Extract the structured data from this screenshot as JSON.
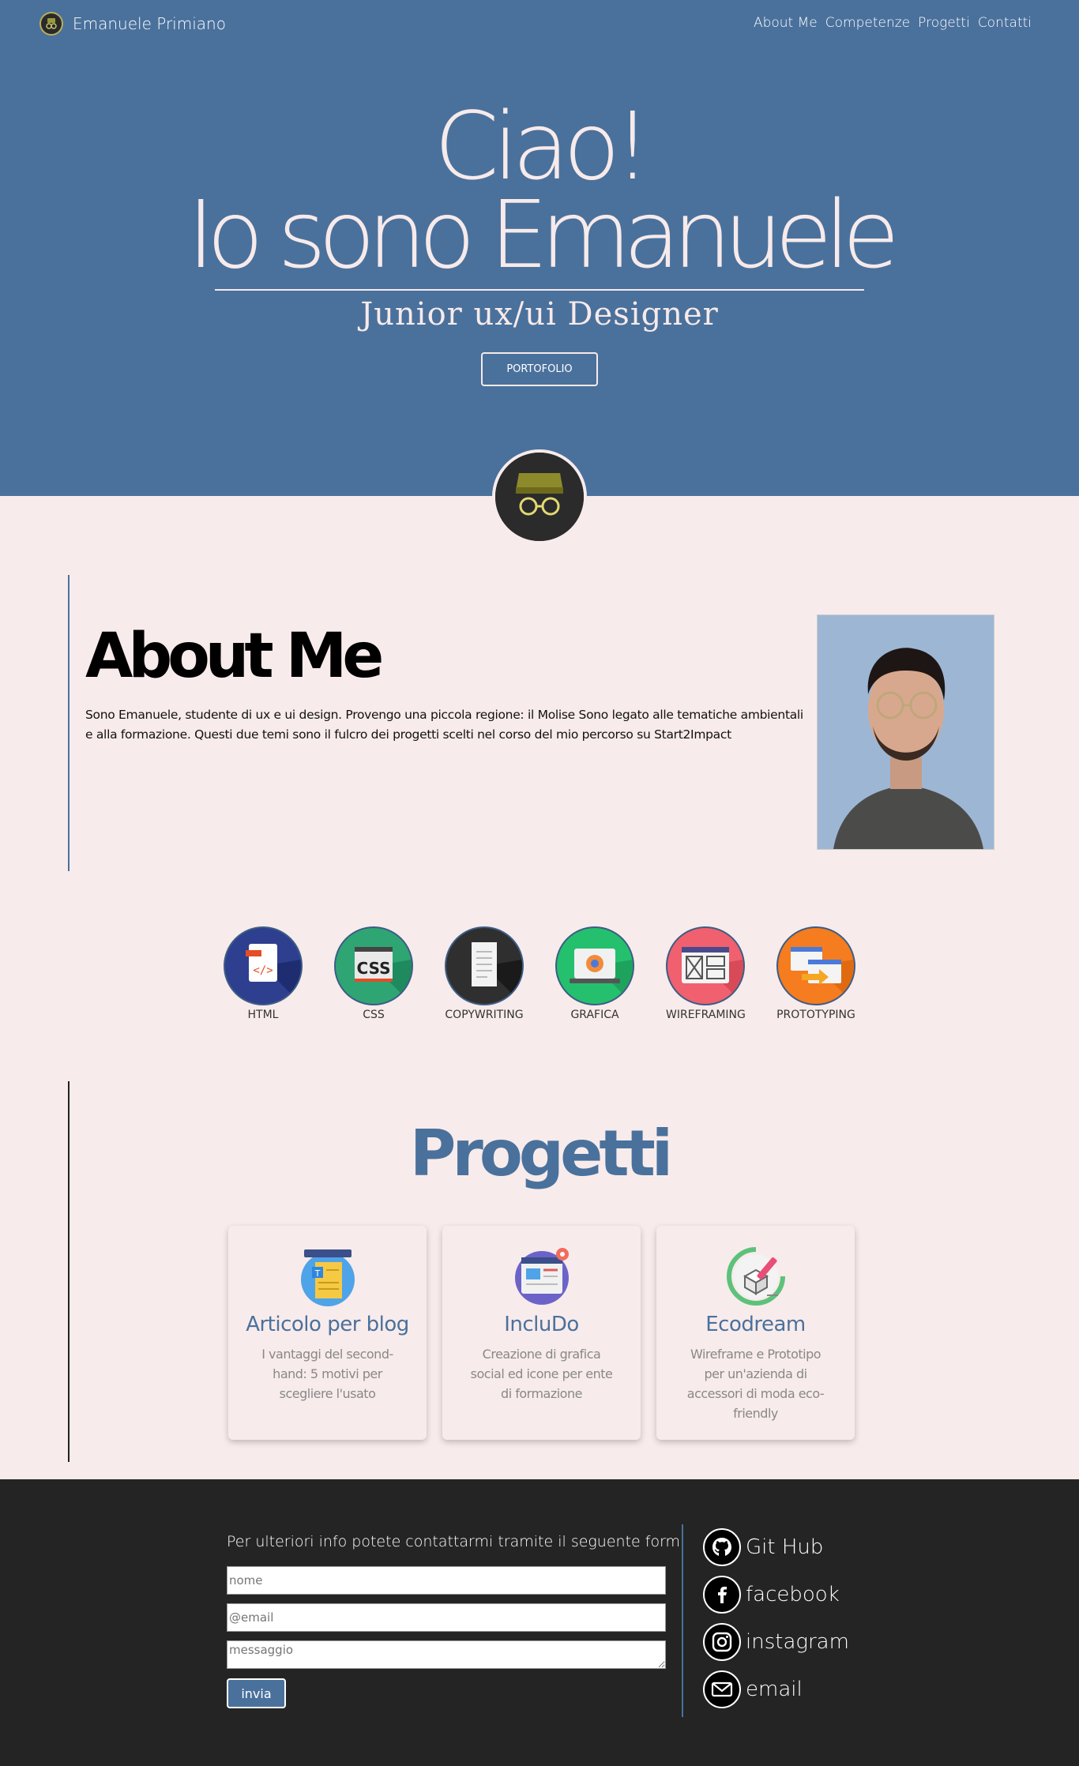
{
  "nav": {
    "brand": "Emanuele Primiano",
    "links": [
      "About Me",
      "Competenze",
      "Progetti",
      "Contatti"
    ]
  },
  "hero": {
    "line1": "Ciao!",
    "line2": "Io sono Emanuele",
    "subtitle": "Junior ux/ui Designer",
    "button": "PORTOFOLIO"
  },
  "about": {
    "title": "About Me",
    "text": "Sono Emanuele, studente di ux e ui design. Provengo una piccola regione: il Molise Sono legato alle tematiche ambientali e alla formazione. Questi due temi sono il fulcro dei progetti scelti nel corso del mio percorso su Start2Impact"
  },
  "skills": [
    {
      "label": "HTML",
      "icon": "html-file-icon",
      "color": "#2e3f8f"
    },
    {
      "label": "CSS",
      "icon": "css-file-icon",
      "color": "#2fa574"
    },
    {
      "label": "COPYWRITING",
      "icon": "document-icon",
      "color": "#2f2f2f"
    },
    {
      "label": "GRAFICA",
      "icon": "monitor-graphics-icon",
      "color": "#25c06d"
    },
    {
      "label": "WIREFRAMING",
      "icon": "wireframe-icon",
      "color": "#f0606e"
    },
    {
      "label": "PROTOTYPING",
      "icon": "prototype-icon",
      "color": "#f57c1f"
    }
  ],
  "projects": {
    "title": "Progetti",
    "items": [
      {
        "title": "Articolo per blog",
        "desc": "I vantaggi del second-hand: 5 motivi per scegliere l'usato",
        "icon": "blog-article-icon"
      },
      {
        "title": "IncluDo",
        "desc": "Creazione di grafica social ed icone per ente di formazione",
        "icon": "web-page-icon"
      },
      {
        "title": "Ecodream",
        "desc": "Wireframe e Prototipo per un'azienda di accessori di moda eco-friendly",
        "icon": "package-design-icon"
      }
    ]
  },
  "contact": {
    "intro": "Per ulteriori info potete contattarmi tramite il seguente form:",
    "name_placeholder": "nome",
    "email_placeholder": "@email",
    "message_placeholder": "messaggio",
    "send": "invia"
  },
  "social": [
    {
      "label": "Git Hub",
      "icon": "github-icon"
    },
    {
      "label": "facebook",
      "icon": "facebook-icon"
    },
    {
      "label": "instagram",
      "icon": "instagram-icon"
    },
    {
      "label": "email",
      "icon": "email-icon"
    }
  ],
  "colors": {
    "primary": "#4a719c",
    "background": "#f8ebeb",
    "footer": "#242424"
  }
}
